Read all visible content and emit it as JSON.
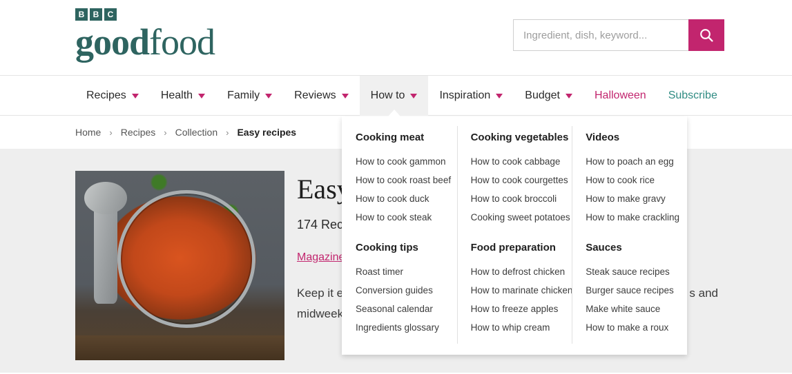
{
  "header": {
    "logo": {
      "bbc_letters": [
        "B",
        "B",
        "C"
      ],
      "word_bold": "good",
      "word_light": "food"
    },
    "search": {
      "placeholder": "Ingredient, dish, keyword...",
      "value": "",
      "button_icon": "search-icon"
    }
  },
  "nav": {
    "items": [
      {
        "label": "Recipes",
        "caret": true,
        "state": "default",
        "active": false
      },
      {
        "label": "Health",
        "caret": true,
        "state": "default",
        "active": false
      },
      {
        "label": "Family",
        "caret": true,
        "state": "default",
        "active": false
      },
      {
        "label": "Reviews",
        "caret": true,
        "state": "default",
        "active": false
      },
      {
        "label": "How to",
        "caret": true,
        "state": "default",
        "active": true
      },
      {
        "label": "Inspiration",
        "caret": true,
        "state": "default",
        "active": false
      },
      {
        "label": "Budget",
        "caret": true,
        "state": "default",
        "active": false
      },
      {
        "label": "Halloween",
        "caret": false,
        "state": "magenta",
        "active": false
      },
      {
        "label": "Subscribe",
        "caret": false,
        "state": "teal",
        "active": false
      }
    ]
  },
  "breadcrumb": {
    "separator": "›",
    "items": [
      {
        "label": "Home",
        "current": false
      },
      {
        "label": "Recipes",
        "current": false
      },
      {
        "label": "Collection",
        "current": false
      },
      {
        "label": "Easy recipes",
        "current": true
      }
    ]
  },
  "content": {
    "image_alt": "gnocchi-bake-photo",
    "title": "Easy",
    "count": "174 Rec",
    "link": "Magazine",
    "body_line1": "Keep it e",
    "body_line1_tail": "s and",
    "body_line2": "midweek"
  },
  "megamenu": {
    "columns": [
      {
        "groups": [
          {
            "heading": "Cooking meat",
            "links": [
              "How to cook gammon",
              "How to cook roast beef",
              "How to cook duck",
              "How to cook steak"
            ]
          },
          {
            "heading": "Cooking tips",
            "links": [
              "Roast timer",
              "Conversion guides",
              "Seasonal calendar",
              "Ingredients glossary"
            ]
          }
        ]
      },
      {
        "groups": [
          {
            "heading": "Cooking vegetables",
            "links": [
              "How to cook cabbage",
              "How to cook courgettes",
              "How to cook broccoli",
              "Cooking sweet potatoes"
            ]
          },
          {
            "heading": "Food preparation",
            "links": [
              "How to defrost chicken",
              "How to marinate chicken",
              "How to freeze apples",
              "How to whip cream"
            ]
          }
        ]
      },
      {
        "groups": [
          {
            "heading": "Videos",
            "links": [
              "How to poach an egg",
              "How to cook rice",
              "How to make gravy",
              "How to make crackling"
            ]
          },
          {
            "heading": "Sauces",
            "links": [
              "Steak sauce recipes",
              "Burger sauce recipes",
              "Make white sauce",
              "How to make a roux"
            ]
          }
        ]
      }
    ]
  },
  "colors": {
    "brand_teal": "#2e6460",
    "accent_magenta": "#c2256e",
    "subscribe_teal": "#2e8b82",
    "content_bg": "#eeeeee",
    "nav_active_bg": "#f0f0f0"
  }
}
